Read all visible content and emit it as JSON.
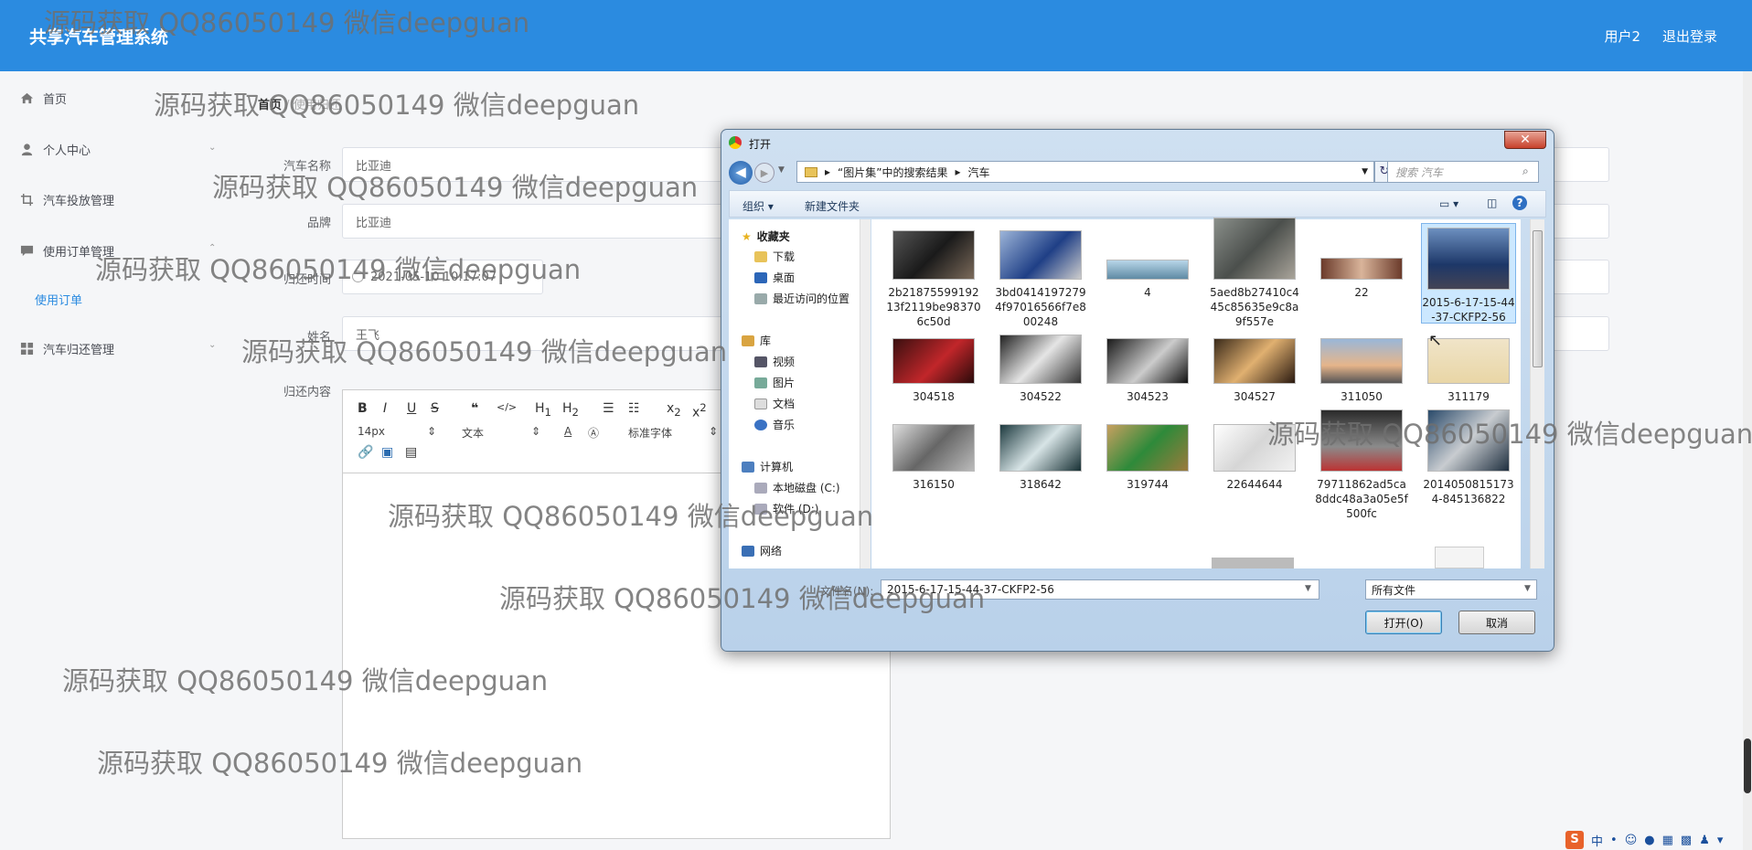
{
  "app": {
    "title": "共享汽车管理系统",
    "user": "用户2",
    "logout": "退出登录"
  },
  "sidebar": {
    "home": "首页",
    "personal": "个人中心",
    "car_release": "汽车投放管理",
    "order_mgmt": "使用订单管理",
    "order_sub": "使用订单",
    "return_mgmt": "汽车归还管理"
  },
  "breadcrumb": {
    "home": "首页",
    "sep": "/",
    "current": "使用归还"
  },
  "form": {
    "car_name_label": "汽车名称",
    "car_name": "比亚迪",
    "brand_label": "品牌",
    "brand": "比亚迪",
    "return_time_label": "归还时间",
    "return_time": "2021-05-10 10:17:07",
    "name_label": "姓名",
    "name": "王飞",
    "content_label": "归还内容"
  },
  "editor": {
    "font_size": "14px",
    "block": "文本",
    "font": "标准字体"
  },
  "dialog": {
    "title": "打开",
    "path_seg1": "“图片集”中的搜索结果",
    "path_seg2": "汽车",
    "search_placeholder": "搜索 汽车",
    "organize": "组织 ▾",
    "new_folder": "新建文件夹",
    "tree": {
      "favorites": "收藏夹",
      "downloads": "下载",
      "desktop": "桌面",
      "recent": "最近访问的位置",
      "library": "库",
      "videos": "视频",
      "pictures": "图片",
      "documents": "文档",
      "music": "音乐",
      "computer": "计算机",
      "disk_c": "本地磁盘 (C:)",
      "disk_d": "软件 (D:)",
      "network": "网络"
    },
    "files": [
      "2b2187559919213f2119be983706c50d",
      "3bd04141972794f97016566f7e800248",
      "4",
      "5aed8b27410c445c85635e9c8a9f557e",
      "22",
      "2015-6-17-15-44-37-CKFP2-56",
      "304518",
      "304522",
      "304523",
      "304527",
      "311050",
      "311179",
      "316150",
      "318642",
      "319744",
      "22644644",
      "79711862ad5ca8ddc48a3a05e5f500fc",
      "2014050815173 4-845136822"
    ],
    "filename_label": "文件名(N):",
    "filename_value": "2015-6-17-15-44-37-CKFP2-56",
    "filetype": "所有文件",
    "open_button": "打开(O)",
    "cancel_button": "取消"
  },
  "watermark": "源码获取 QQ86050149 微信deepguan",
  "tray": {
    "ime": "中"
  }
}
